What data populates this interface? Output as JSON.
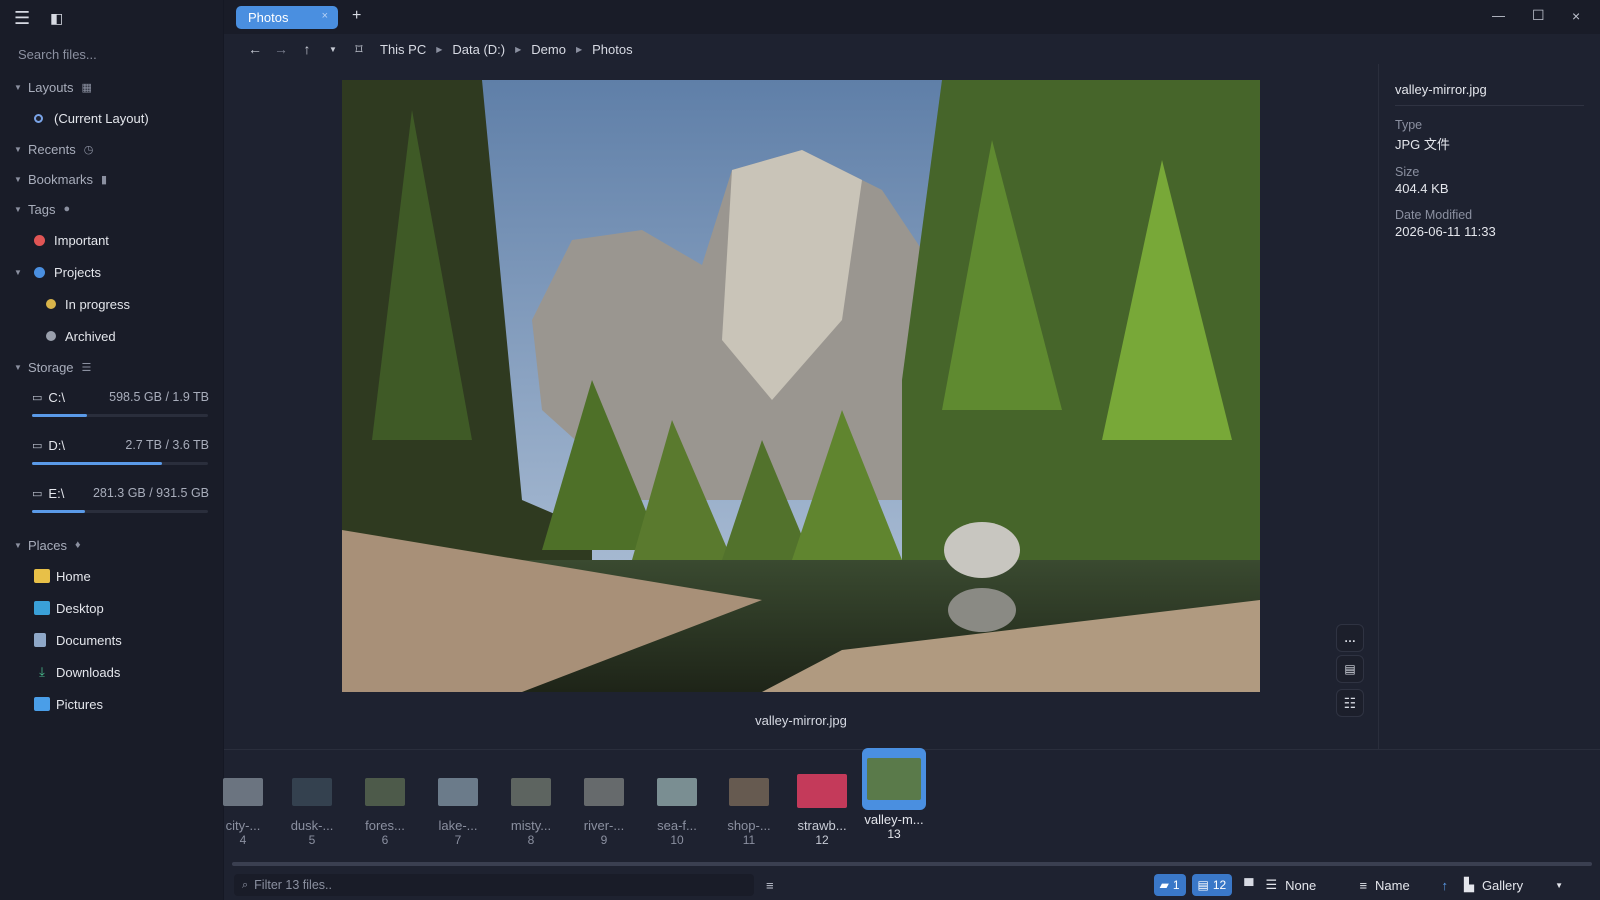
{
  "colors": {
    "accent": "#4a8fe0",
    "important": "#e05555",
    "projects": "#4a8fe0",
    "in_progress": "#d9b44a",
    "archived": "#9aa0ad"
  },
  "sidebar": {
    "search_placeholder": "Search files...",
    "layouts": {
      "title": "Layouts",
      "items": [
        "(Current Layout)"
      ]
    },
    "recents": {
      "title": "Recents"
    },
    "bookmarks": {
      "title": "Bookmarks"
    },
    "tags": {
      "title": "Tags",
      "important": "Important",
      "projects": "Projects",
      "in_progress": "In progress",
      "archived": "Archived"
    },
    "storage": {
      "title": "Storage",
      "drives": [
        {
          "name": "C:\\",
          "size": "598.5 GB / 1.9 TB",
          "used_percent": 31
        },
        {
          "name": "D:\\",
          "size": "2.7 TB / 3.6 TB",
          "used_percent": 74
        },
        {
          "name": "E:\\",
          "size": "281.3 GB / 931.5 GB",
          "used_percent": 30
        }
      ]
    },
    "places": {
      "title": "Places",
      "home": "Home",
      "desktop": "Desktop",
      "documents": "Documents",
      "downloads": "Downloads",
      "pictures": "Pictures"
    }
  },
  "tab": {
    "label": "Photos",
    "close": "×",
    "add": "+"
  },
  "window": {
    "minimize": "—",
    "maximize": "☐",
    "close": "×"
  },
  "breadcrumb": [
    "This PC",
    "Data (D:)",
    "Demo",
    "Photos"
  ],
  "preview": {
    "caption": "valley-mirror.jpg",
    "more": "…"
  },
  "properties": {
    "name": "valley-mirror.jpg",
    "type_label": "Type",
    "type_value": "JPG 文件",
    "size_label": "Size",
    "size_value": "404.4 KB",
    "date_label": "Date Modified",
    "date_value": "2026-06-11 11:33"
  },
  "thumbnails": [
    {
      "name": "city-...",
      "num": "4",
      "color": "#6b7480"
    },
    {
      "name": "dusk-...",
      "num": "5",
      "color": "#34414f"
    },
    {
      "name": "fores...",
      "num": "6",
      "color": "#4d5a4a"
    },
    {
      "name": "lake-...",
      "num": "7",
      "color": "#6b7b8a"
    },
    {
      "name": "misty...",
      "num": "8",
      "color": "#5d6460"
    },
    {
      "name": "river-...",
      "num": "9",
      "color": "#666a6c"
    },
    {
      "name": "sea-f...",
      "num": "10",
      "color": "#7a8e92"
    },
    {
      "name": "shop-...",
      "num": "11",
      "color": "#665a50"
    },
    {
      "name": "strawb...",
      "num": "12",
      "color": "#c43a5a"
    },
    {
      "name": "valley-m...",
      "num": "13",
      "color": "#5a7a4a"
    }
  ],
  "statusbar": {
    "filter_placeholder": "Filter 13 files..",
    "folders_count": "1",
    "files_count": "12",
    "group": "None",
    "sort": "Name",
    "sort_dir": "↑",
    "view": "Gallery"
  }
}
